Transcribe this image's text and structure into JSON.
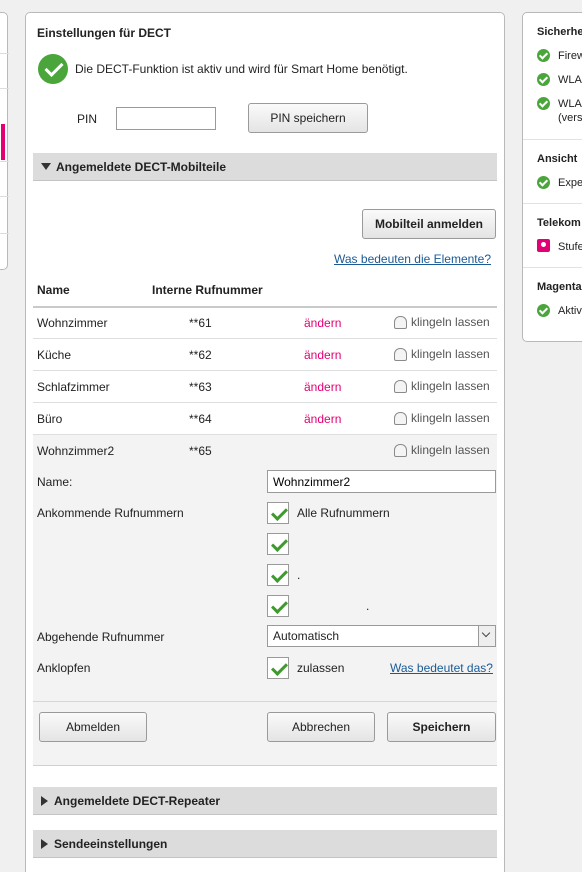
{
  "right_sidebar": {
    "sections": [
      {
        "heading": "Sicherhe",
        "items": [
          {
            "label": "Firew",
            "status": "ok"
          },
          {
            "label": "WLA",
            "status": "ok"
          },
          {
            "label": "WLA",
            "sub": "(vers",
            "status": "ok"
          }
        ]
      },
      {
        "heading": "Ansicht",
        "items": [
          {
            "label": "Expe",
            "status": "ok"
          }
        ]
      },
      {
        "heading": "Telekom",
        "items": [
          {
            "label": "Stufe",
            "status": "pink"
          }
        ]
      },
      {
        "heading": "Magenta",
        "items": [
          {
            "label": "Aktiv",
            "status": "ok"
          }
        ]
      }
    ]
  },
  "dect": {
    "title": "Einstellungen für DECT",
    "status_text": "Die DECT-Funktion ist aktiv und wird für Smart Home benötigt.",
    "pin_label": "PIN",
    "pin_value": "",
    "pin_save_label": "PIN speichern"
  },
  "handsets": {
    "section_title": "Angemeldete DECT-Mobilteile",
    "register_button": "Mobilteil anmelden",
    "help_link": "Was bedeuten die Elemente?",
    "columns": [
      "Name",
      "Interne Rufnummer"
    ],
    "change_label": "ändern",
    "ring_label": "klingeln lassen",
    "rows": [
      {
        "name": "Wohnzimmer",
        "number": "**61"
      },
      {
        "name": "Küche",
        "number": "**62"
      },
      {
        "name": "Schlafzimmer",
        "number": "**63"
      },
      {
        "name": "Büro",
        "number": "**64"
      }
    ],
    "expanded": {
      "name": "Wohnzimmer2",
      "number": "**65",
      "name_label": "Name:",
      "name_value": "Wohnzimmer2",
      "incoming_label": "Ankommende Rufnummern",
      "incoming_options": [
        "Alle Rufnummern",
        "",
        ".",
        "."
      ],
      "outgoing_label": "Abgehende Rufnummer",
      "outgoing_value": "Automatisch",
      "knock_label": "Anklopfen",
      "knock_option": "zulassen",
      "knock_help": "Was bedeutet das?",
      "logout_button": "Abmelden",
      "cancel_button": "Abbrechen",
      "save_button": "Speichern"
    }
  },
  "collapsed_sections": [
    "Angemeldete DECT-Repeater",
    "Sendeeinstellungen"
  ]
}
